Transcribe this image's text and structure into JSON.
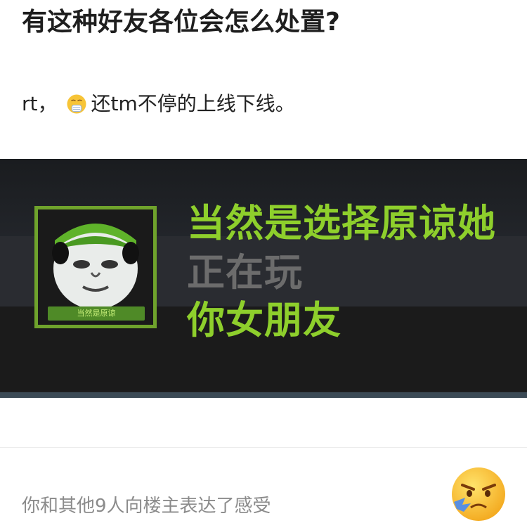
{
  "post": {
    "title": "有这种好友各位会怎么处置?",
    "body_prefix": "rt，",
    "body_emoji": "sneeze-face-icon",
    "body_suffix": "还tm不停的上线下线。"
  },
  "image": {
    "status_line1": "当然是选择原谅她",
    "status_line2": "正在玩",
    "status_line3": "你女朋友",
    "avatar_caption": "当然是原谅",
    "colors": {
      "green": "#8ecf2c",
      "gray": "#6c6c6c",
      "background": "#1d1d1d"
    }
  },
  "footer": {
    "reaction_text": "你和其他9人向楼主表达了感受",
    "reaction_emoji": "angry-face-icon"
  }
}
